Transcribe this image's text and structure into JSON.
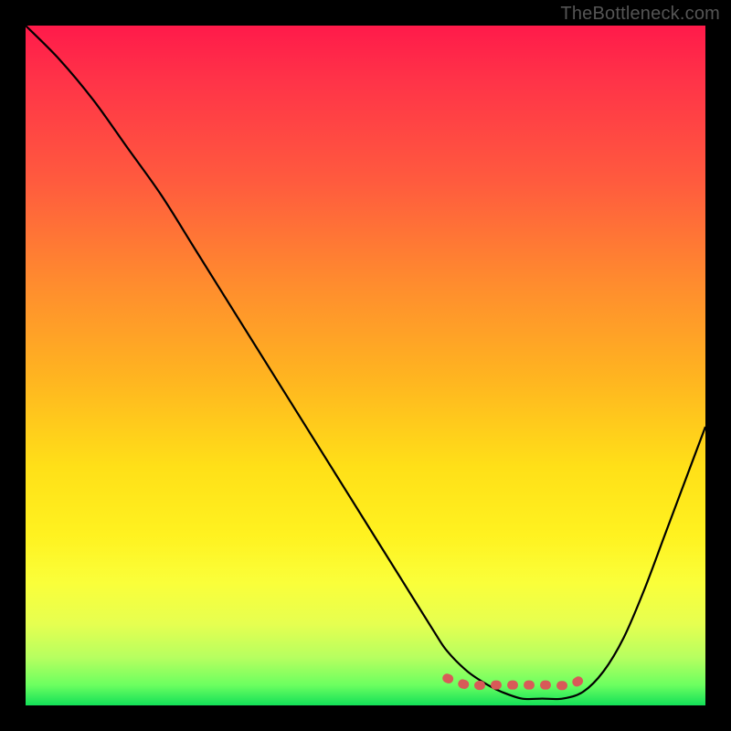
{
  "watermark": "TheBottleneck.com",
  "chart_data": {
    "type": "line",
    "title": "",
    "xlabel": "",
    "ylabel": "",
    "xlim": [
      0,
      100
    ],
    "ylim": [
      0,
      100
    ],
    "grid": false,
    "legend": false,
    "background": {
      "gradient": "vertical",
      "stops": [
        {
          "pos": 0,
          "color": "#ff1a4a"
        },
        {
          "pos": 23,
          "color": "#ff5b3e"
        },
        {
          "pos": 52,
          "color": "#ffb520"
        },
        {
          "pos": 75,
          "color": "#fff220"
        },
        {
          "pos": 93,
          "color": "#b6ff60"
        },
        {
          "pos": 100,
          "color": "#13e058"
        }
      ]
    },
    "series": [
      {
        "name": "bottleneck-curve",
        "color": "#000000",
        "x": [
          0,
          5,
          10,
          15,
          20,
          25,
          30,
          35,
          40,
          45,
          50,
          55,
          60,
          62,
          65,
          68,
          70,
          73,
          76,
          79,
          82,
          85,
          88,
          91,
          94,
          97,
          100
        ],
        "y": [
          100,
          95,
          89,
          82,
          75,
          67,
          59,
          51,
          43,
          35,
          27,
          19,
          11,
          8,
          5,
          3,
          2,
          1,
          1,
          1,
          2,
          5,
          10,
          17,
          25,
          33,
          41
        ]
      },
      {
        "name": "optimal-range-markers",
        "color": "#d85a58",
        "style": "dotted",
        "x": [
          62,
          65,
          68,
          71,
          74,
          77,
          80,
          82
        ],
        "y": [
          4,
          3,
          3,
          3,
          3,
          3,
          3,
          4
        ]
      }
    ],
    "annotations": []
  }
}
